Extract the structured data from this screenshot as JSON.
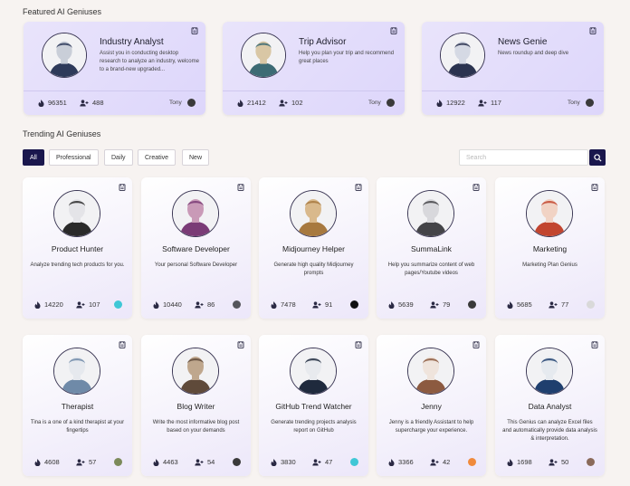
{
  "featured": {
    "title": "Featured AI Geniuses",
    "cards": [
      {
        "name": "Industry Analyst",
        "desc": "Assist you in conducting desktop research to analyze an industry, welcome to a brand-new upgraded...",
        "uses": "96351",
        "users": "488",
        "owner": "Tony",
        "owner_color": "#3a3a3a",
        "avatar_color": "#c9ced8",
        "avatar_body": "#2e3a5a"
      },
      {
        "name": "Trip Advisor",
        "desc": "Help you plan your trip and recommend great places",
        "uses": "21412",
        "users": "102",
        "owner": "Tony",
        "owner_color": "#3a3a3a",
        "avatar_color": "#d9c7a5",
        "avatar_body": "#3c6b74"
      },
      {
        "name": "News Genie",
        "desc": "News roundup and deep dive",
        "uses": "12922",
        "users": "117",
        "owner": "Tony",
        "owner_color": "#3a3a3a",
        "avatar_color": "#d5d9e4",
        "avatar_body": "#2b3350"
      }
    ]
  },
  "trending": {
    "title": "Trending AI Geniuses",
    "filters": [
      "All",
      "Professional",
      "Daily",
      "Creative",
      "New"
    ],
    "active_filter": "All",
    "search_placeholder": "Search",
    "cards": [
      {
        "name": "Product Hunter",
        "desc": "Analyze trending tech products for you.",
        "uses": "14220",
        "users": "107",
        "owner_color": "#3fc7d6",
        "avatar_color": "#e4e4e8",
        "avatar_body": "#2a2a2a"
      },
      {
        "name": "Software Developer",
        "desc": "Your personal Software Developer",
        "uses": "10440",
        "users": "86",
        "owner_color": "#55565c",
        "avatar_color": "#c99ab7",
        "avatar_body": "#7a3b76"
      },
      {
        "name": "Midjourney Helper",
        "desc": "Generate high quality Midjourney prompts",
        "uses": "7478",
        "users": "91",
        "owner_color": "#111111",
        "avatar_color": "#d9b98c",
        "avatar_body": "#a7793f"
      },
      {
        "name": "SummaLink",
        "desc": "Help you summarize content of web pages/Youtube videos",
        "uses": "5639",
        "users": "79",
        "owner_color": "#3a3a3a",
        "avatar_color": "#d8d8dc",
        "avatar_body": "#444448"
      },
      {
        "name": "Marketing",
        "desc": "Marketing Plan Genius",
        "uses": "5685",
        "users": "77",
        "owner_color": "#d9d9d9",
        "avatar_color": "#f1d3c4",
        "avatar_body": "#c2452f"
      },
      {
        "name": "Therapist",
        "desc": "Tina is a one of a kind therapist at your fingertips",
        "uses": "4608",
        "users": "57",
        "owner_color": "#7c8a5a",
        "avatar_color": "#e6e9ee",
        "avatar_body": "#6f8aa8"
      },
      {
        "name": "Blog Writer",
        "desc": "Write the most informative blog post based on your demands",
        "uses": "4463",
        "users": "54",
        "owner_color": "#3a3a3a",
        "avatar_color": "#bfa78d",
        "avatar_body": "#5f4a3a"
      },
      {
        "name": "GitHub Trend Watcher",
        "desc": "Generate trending projects analysis report on GitHub",
        "uses": "3830",
        "users": "47",
        "owner_color": "#3fc7d6",
        "avatar_color": "#e8eaee",
        "avatar_body": "#1f2a3d"
      },
      {
        "name": "Jenny",
        "desc": "Jenny is a friendly Assistant to help supercharge your experience.",
        "uses": "3366",
        "users": "42",
        "owner_color": "#f08a3c",
        "avatar_color": "#efe4dc",
        "avatar_body": "#8c5a40"
      },
      {
        "name": "Data Analyst",
        "desc": "This Genius can analyze Excel files and automatically provide data analysis & interpretation.",
        "uses": "1698",
        "users": "50",
        "owner_color": "#8a6a5a",
        "avatar_color": "#e6eaef",
        "avatar_body": "#1f3f6e"
      }
    ]
  }
}
